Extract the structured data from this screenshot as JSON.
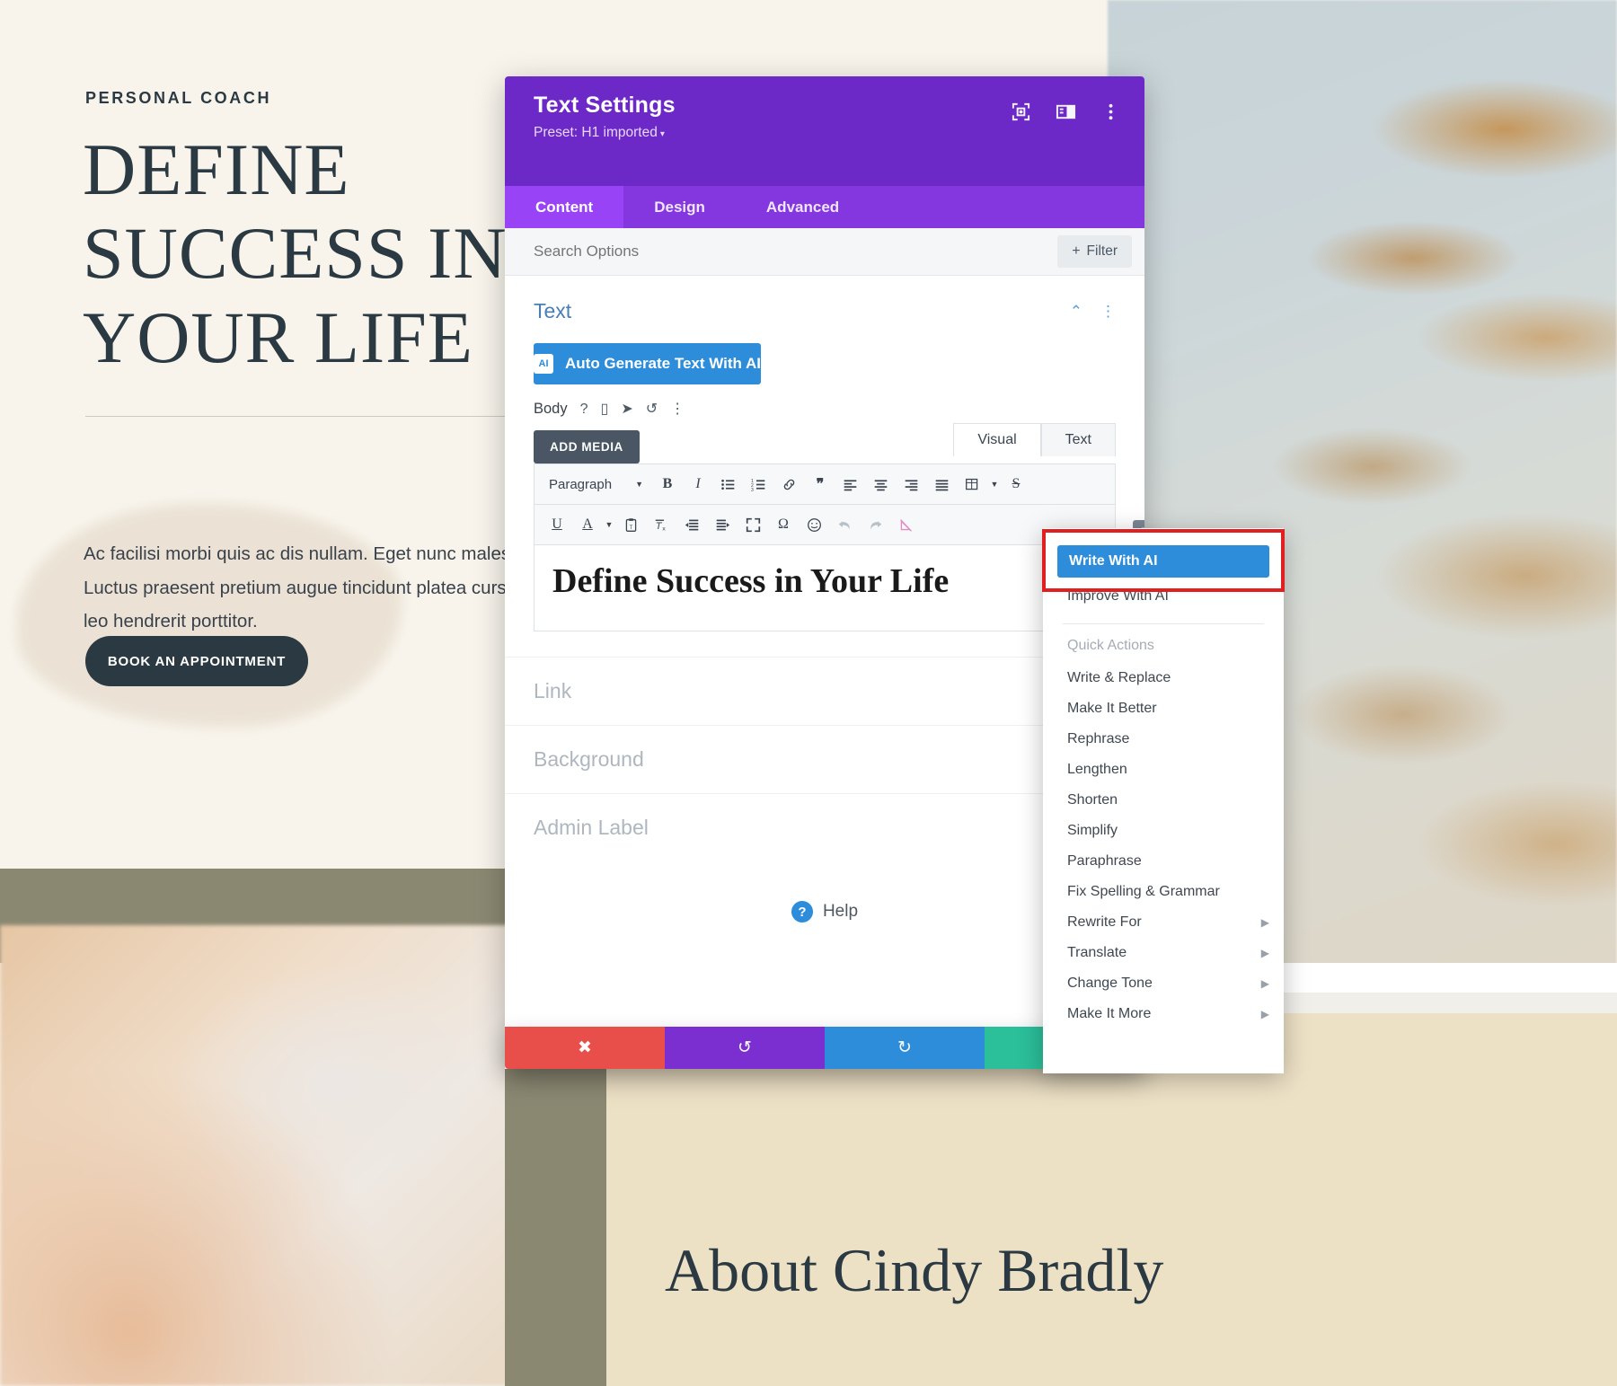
{
  "website": {
    "eyebrow": "PERSONAL COACH",
    "title": "DEFINE SUCCESS IN YOUR LIFE",
    "body": "Ac facilisi morbi quis ac dis nullam. Eget nunc malesuada hac vestibulum. Luctus praesent pretium augue tincidunt platea cursus quam ultricies. Turpis leo hendrerit porttitor.",
    "cta": "BOOK AN APPOINTMENT",
    "about_title": "About Cindy Bradly"
  },
  "modal": {
    "title": "Text Settings",
    "preset": "Preset: H1 imported",
    "preset_caret": "▾",
    "icons": [
      {
        "name": "focus-frame-icon"
      },
      {
        "name": "layout-panel-icon"
      },
      {
        "name": "kebab-menu-icon"
      }
    ],
    "tabs": [
      {
        "label": "Content",
        "active": true
      },
      {
        "label": "Design",
        "active": false
      },
      {
        "label": "Advanced",
        "active": false
      }
    ],
    "search": {
      "placeholder": "Search Options",
      "value": ""
    },
    "filter_label": "Filter",
    "filter_plus": "+",
    "section": {
      "title": "Text",
      "collapse_icon": "⌃",
      "kebab_icon": "⋮"
    },
    "ai_button": {
      "label": "Auto Generate Text With AI",
      "badge": "AI"
    },
    "body_row": {
      "label": "Body",
      "icons": [
        "?",
        "▯",
        "➤",
        "↺",
        "⋮"
      ]
    },
    "add_media": "ADD MEDIA",
    "editor_tabs": [
      {
        "label": "Visual",
        "active": true
      },
      {
        "label": "Text",
        "active": false
      }
    ],
    "format_select": "Paragraph",
    "toolbar_row1": [
      "B",
      "I",
      "☰",
      "☷",
      "🔗",
      "❝",
      "≡",
      "≡",
      "≡",
      "≣",
      "▦",
      "S"
    ],
    "toolbar_row2": [
      "U",
      "A",
      "▾",
      "📋",
      "Tx",
      "⇤",
      "⇥",
      "⤢",
      "Ω",
      "☺",
      "↶",
      "↷",
      "▨"
    ],
    "editor_content": "Define Success in Your Life",
    "editor_ai_badge": "AI",
    "option_rows": [
      "Link",
      "Background",
      "Admin Label"
    ],
    "help_label": "Help",
    "help_icon": "?",
    "footer_buttons": [
      {
        "name": "discard-button",
        "glyph": "✖",
        "color": "#e94f4a"
      },
      {
        "name": "undo-button",
        "glyph": "↺",
        "color": "#7b2fd0"
      },
      {
        "name": "redo-button",
        "glyph": "↻",
        "color": "#2d8ddb"
      },
      {
        "name": "save-button",
        "glyph": "✓",
        "color": "#2bbf9a"
      }
    ]
  },
  "ai_menu": {
    "primary": "Write With AI",
    "secondary": "Improve With AI",
    "group_label": "Quick Actions",
    "items": [
      {
        "label": "Write & Replace",
        "submenu": false
      },
      {
        "label": "Make It Better",
        "submenu": false
      },
      {
        "label": "Rephrase",
        "submenu": false
      },
      {
        "label": "Lengthen",
        "submenu": false
      },
      {
        "label": "Shorten",
        "submenu": false
      },
      {
        "label": "Simplify",
        "submenu": false
      },
      {
        "label": "Paraphrase",
        "submenu": false
      },
      {
        "label": "Fix Spelling & Grammar",
        "submenu": false
      },
      {
        "label": "Rewrite For",
        "submenu": true
      },
      {
        "label": "Translate",
        "submenu": true
      },
      {
        "label": "Change Tone",
        "submenu": true
      },
      {
        "label": "Make It More",
        "submenu": true
      }
    ],
    "submenu_arrow": "▶",
    "highlight_color": "#e02020"
  }
}
